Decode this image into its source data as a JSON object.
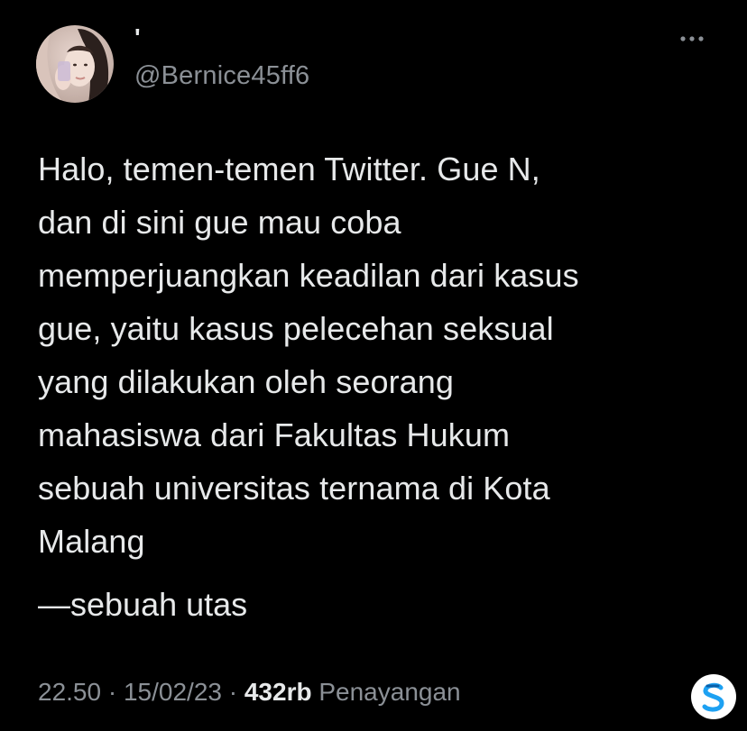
{
  "author": {
    "display_name": "'",
    "handle": "@Bernice45ff6",
    "avatar_icon": "user-avatar-photo"
  },
  "menu": {
    "more_icon": "more-horizontal-icon"
  },
  "tweet": {
    "text": "Halo, temen-temen Twitter. Gue N,\ndan di sini gue mau coba\nmemperjuangkan keadilan dari kasus\ngue, yaitu kasus pelecehan seksual\nyang dilakukan oleh seorang\nmahasiswa dari Fakultas Hukum\nsebuah universitas ternama di Kota\nMalang",
    "thread_note": "—sebuah utas"
  },
  "meta": {
    "time": "22.50",
    "separator": "·",
    "date": "15/02/23",
    "views_count": "432rb",
    "views_label": "Penayangan"
  },
  "colors": {
    "background": "#000000",
    "text_primary": "#e7e9ea",
    "text_secondary": "#8b9096",
    "watermark_accent": "#1da1f2"
  },
  "watermark": {
    "icon": "s-logo-watermark"
  }
}
